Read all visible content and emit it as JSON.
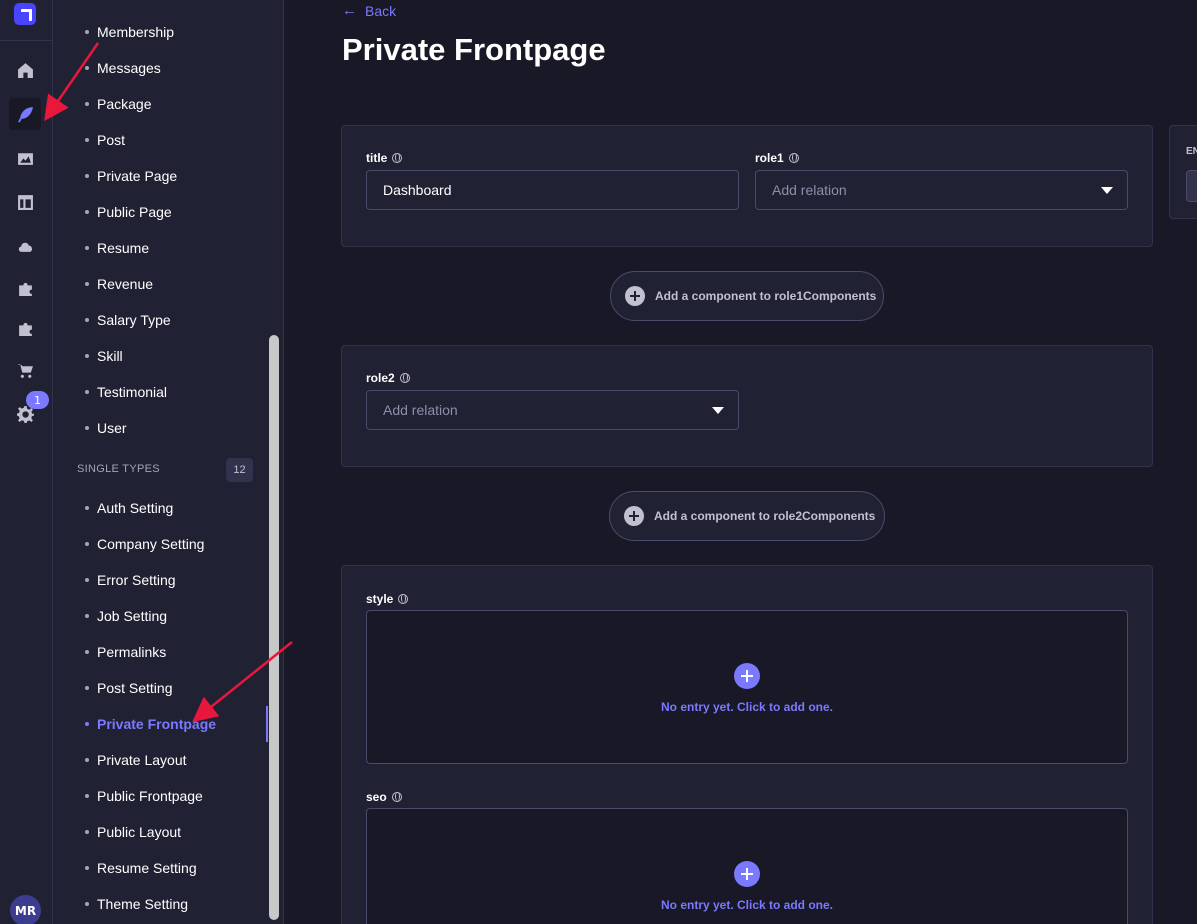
{
  "page": {
    "back_label": "Back",
    "title": "Private Frontpage"
  },
  "rail": {
    "badge_count": "1",
    "avatar_initials": "MR"
  },
  "nav": {
    "collection_items": [
      "Membership",
      "Messages",
      "Package",
      "Post",
      "Private Page",
      "Public Page",
      "Resume",
      "Revenue",
      "Salary Type",
      "Skill",
      "Testimonial",
      "User"
    ],
    "single_types_header": "SINGLE TYPES",
    "single_types_count": "12",
    "single_items": [
      "Auth Setting",
      "Company Setting",
      "Error Setting",
      "Job Setting",
      "Permalinks",
      "Post Setting",
      "Private Frontpage",
      "Private Layout",
      "Public Frontpage",
      "Public Layout",
      "Resume Setting",
      "Theme Setting"
    ],
    "active_item": "Private Frontpage"
  },
  "form": {
    "title_label": "title",
    "title_value": "Dashboard",
    "role1_label": "role1",
    "role1_placeholder": "Add relation",
    "add_role1_components": "Add a component to role1Components",
    "role2_label": "role2",
    "role2_placeholder": "Add relation",
    "add_role2_components": "Add a component to role2Components",
    "style_label": "style",
    "style_empty": "No entry yet. Click to add one.",
    "seo_label": "seo",
    "seo_empty": "No entry yet. Click to add one."
  },
  "side_panel": {
    "label": "EN"
  },
  "colors": {
    "accent": "#7b79ff",
    "annotation_arrow": "#e8173c",
    "background": "#181826",
    "panel": "#212134"
  }
}
